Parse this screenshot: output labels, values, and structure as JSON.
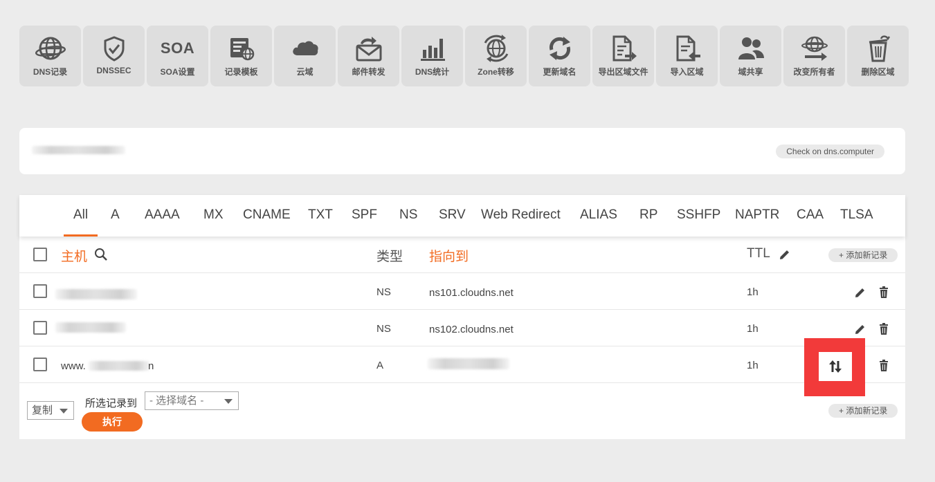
{
  "toolbar": [
    {
      "label": "DNS记录",
      "icon": "globe-icon"
    },
    {
      "label": "DNSSEC",
      "icon": "shield-check-icon"
    },
    {
      "label": "SOA设置",
      "icon": "soa-text-icon",
      "text": "SOA"
    },
    {
      "label": "记录模板",
      "icon": "template-icon"
    },
    {
      "label": "云域",
      "icon": "cloud-icon"
    },
    {
      "label": "邮件转发",
      "icon": "mail-forward-icon"
    },
    {
      "label": "DNS统计",
      "icon": "bar-chart-icon"
    },
    {
      "label": "Zone转移",
      "icon": "zone-transfer-icon"
    },
    {
      "label": "更新域名",
      "icon": "refresh-icon"
    },
    {
      "label": "导出区域文件",
      "icon": "export-file-icon"
    },
    {
      "label": "导入区域",
      "icon": "import-file-icon"
    },
    {
      "label": "域共享",
      "icon": "users-icon"
    },
    {
      "label": "改变所有者",
      "icon": "change-owner-icon"
    },
    {
      "label": "删除区域",
      "icon": "trash-icon"
    }
  ],
  "domain_panel": {
    "check_button": "Check on dns.computer"
  },
  "tabs": [
    "All",
    "A",
    "AAAA",
    "MX",
    "CNAME",
    "TXT",
    "SPF",
    "NS",
    "SRV",
    "Web Redirect",
    "ALIAS",
    "RP",
    "SSHFP",
    "NAPTR",
    "CAA",
    "TLSA"
  ],
  "active_tab": "All",
  "table": {
    "headers": {
      "host": "主机",
      "type": "类型",
      "points_to": "指向到",
      "ttl": "TTL"
    },
    "add_record": "+ 添加新记录",
    "rows": [
      {
        "host": "",
        "type": "NS",
        "points_to": "ns101.cloudns.net",
        "ttl": "1h"
      },
      {
        "host": "",
        "type": "NS",
        "points_to": "ns102.cloudns.net",
        "ttl": "1h"
      },
      {
        "host_prefix": "www.",
        "host_suffix": "n",
        "type": "A",
        "points_to": "",
        "ttl": "1h"
      }
    ]
  },
  "bottom": {
    "action_select": "复制",
    "move_label": "所选记录到",
    "domain_select": "- 选择域名 -",
    "execute": "执行",
    "add_record": "+ 添加新记录"
  },
  "colors": {
    "accent": "#f26b21",
    "highlight": "#f23a3a"
  }
}
